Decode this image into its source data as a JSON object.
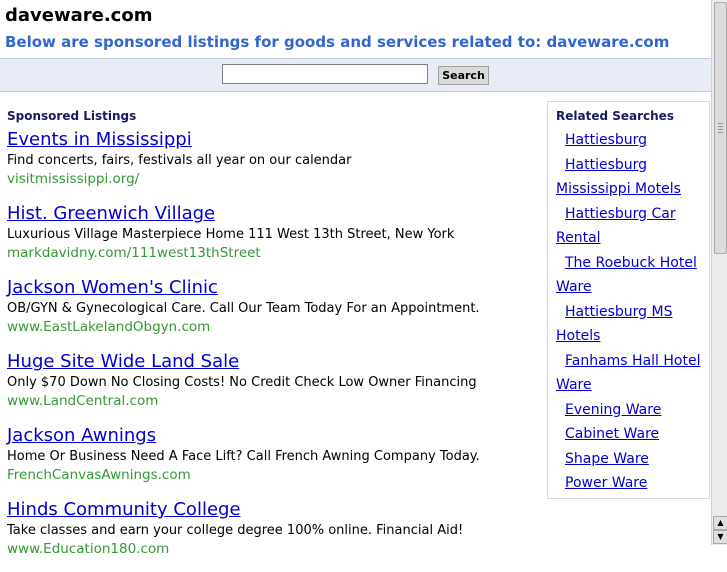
{
  "header": {
    "title": "daveware.com",
    "subtitle": "Below are sponsored listings for goods and services related to: daveware.com"
  },
  "search": {
    "placeholder": "",
    "value": "",
    "button_label": "Search"
  },
  "sponsored": {
    "heading": "Sponsored Listings",
    "items": [
      {
        "title": "Events in Mississippi",
        "desc": "Find concerts, fairs, festivals all year on our calendar",
        "url": "visitmississippi.org/"
      },
      {
        "title": "Hist. Greenwich Village",
        "desc": "Luxurious Village Masterpiece Home 111 West 13th Street, New York",
        "url": "markdavidny.com/111west13thStreet"
      },
      {
        "title": "Jackson Women's Clinic",
        "desc": "OB/GYN & Gynecological Care. Call Our Team Today For an Appointment.",
        "url": "www.EastLakelandObgyn.com"
      },
      {
        "title": "Huge Site Wide Land Sale",
        "desc": "Only $70 Down No Closing Costs! No Credit Check Low Owner Financing",
        "url": "www.LandCentral.com"
      },
      {
        "title": "Jackson Awnings",
        "desc": "Home Or Business Need A Face Lift? Call French Awning Company Today.",
        "url": "FrenchCanvasAwnings.com"
      },
      {
        "title": "Hinds Community College",
        "desc": "Take classes and earn your college degree 100% online. Financial Aid!",
        "url": "www.Education180.com"
      }
    ]
  },
  "related": {
    "heading": "Related Searches",
    "items": [
      {
        "lines": [
          "Hattiesburg"
        ]
      },
      {
        "lines": [
          "Hattiesburg"
        ]
      },
      {
        "lines": [
          "Mississippi Motels"
        ]
      },
      {
        "lines": [
          "Hattiesburg Car",
          "Rental"
        ]
      },
      {
        "lines": [
          "The Roebuck Hotel",
          "Ware"
        ]
      },
      {
        "lines": [
          "Hattiesburg MS",
          "Hotels"
        ]
      },
      {
        "lines": [
          "Fanhams Hall Hotel",
          "Ware"
        ]
      },
      {
        "lines": [
          "Evening Ware"
        ]
      },
      {
        "lines": [
          "Cabinet Ware"
        ]
      },
      {
        "lines": [
          "Shape Ware"
        ]
      },
      {
        "lines": [
          "Power Ware"
        ]
      }
    ]
  },
  "scrollbar": {
    "up_arrow": "▲",
    "down_arrow": "▼"
  }
}
